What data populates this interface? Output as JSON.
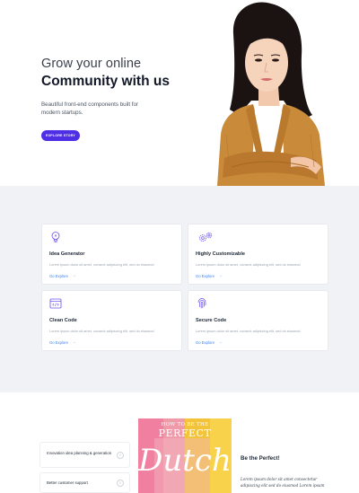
{
  "hero": {
    "title_light": "Grow your online",
    "title_bold": "Community with us",
    "description": "Beautiful front-end components built for modern startups.",
    "cta_label": "EXPLORE STORY",
    "accent": "#4f2fe6"
  },
  "features": {
    "cards": [
      {
        "icon": "lightbulb-icon",
        "title": "Idea Generator",
        "desc": "Lorem ipsum dolor sit amet, consect adipiscing elit, sed do eiusmod",
        "link": "Go Explore"
      },
      {
        "icon": "gears-icon",
        "title": "Highly Customizable",
        "desc": "Lorem ipsum dolor sit amet, consect adipiscing elit, sed do eiusmod",
        "link": "Go Explore"
      },
      {
        "icon": "code-window-icon",
        "title": "Clean Code",
        "desc": "Lorem ipsum dolor sit amet, consect adipiscing elit, sed do eiusmod",
        "link": "Go Explore"
      },
      {
        "icon": "fingerprint-icon",
        "title": "Secure Code",
        "desc": "Lorem ipsum dolor sit amet, consect adipiscing elit, sed do eiusmod",
        "link": "Go Explore"
      }
    ]
  },
  "bottom": {
    "accordion": [
      {
        "label": "Innovation idea planning & generation"
      },
      {
        "label": "Better customer support"
      }
    ],
    "poster": {
      "top_text": "HOW TO BE THE",
      "perfect": "PERFECT",
      "script": "Dutch"
    },
    "title": "Be the Perfect!",
    "desc": "Lorem ipsum dolor sit amet consectetur adipiscing elit sed do eiusmod Lorem ipsum"
  }
}
